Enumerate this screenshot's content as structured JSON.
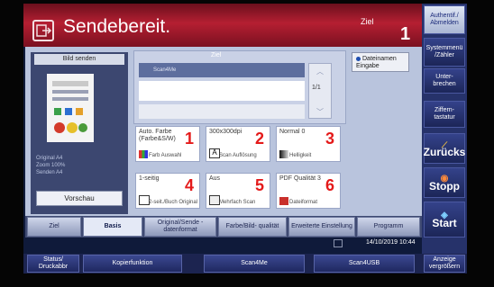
{
  "header": {
    "title": "Sendebereit.",
    "ziel_label": "Ziel",
    "ziel_count": "1"
  },
  "left_panel": {
    "send_label": "Bild senden",
    "meta_lines": [
      "Original   A4",
      "Zoom       100%",
      "Senden     A4"
    ],
    "preview_button": "Vorschau"
  },
  "destination": {
    "label": "Ziel",
    "entry": "Scan4Me",
    "page_indicator": "1/1",
    "filename_button": "Dateinamen Eingabe"
  },
  "tiles": [
    {
      "label": "Auto. Farbe (Farbe&S/W)",
      "sub": "Farb Auswahl",
      "num": "1"
    },
    {
      "label": "300x300dpi",
      "sub": "Scan Auflösung",
      "num": "2"
    },
    {
      "label": "Normal 0",
      "sub": "Helligkeit",
      "num": "3"
    },
    {
      "label": "1-seitig",
      "sub": "2-seit./Buch Original",
      "num": "4"
    },
    {
      "label": "Aus",
      "sub": "Mehrfach Scan",
      "num": "5"
    },
    {
      "label": "PDF Qualität 3",
      "sub": "Dateiformat",
      "num": "6"
    }
  ],
  "tabs": [
    "Ziel",
    "Basis",
    "Original/Sende -datenformat",
    "Farbe/Bild- qualität",
    "Erweiterte Einstellung",
    "Programm"
  ],
  "status": {
    "datetime": "14/10/2019 10:44"
  },
  "right_panel": {
    "auth": "Authentif./ Abmelden",
    "menu": "Systemmenü /Zähler",
    "interrupt": "Unter- brechen",
    "numkeys": "Ziffern- tastatur",
    "reset": "Zurücks",
    "stop": "Stopp",
    "start": "Start"
  },
  "bottom": {
    "status": "Status/ Druckabbr",
    "copy": "Kopierfunktion",
    "scan4me": "Scan4Me",
    "scan4usb": "Scan4USB",
    "zoom": "Anzeige vergrößern"
  }
}
